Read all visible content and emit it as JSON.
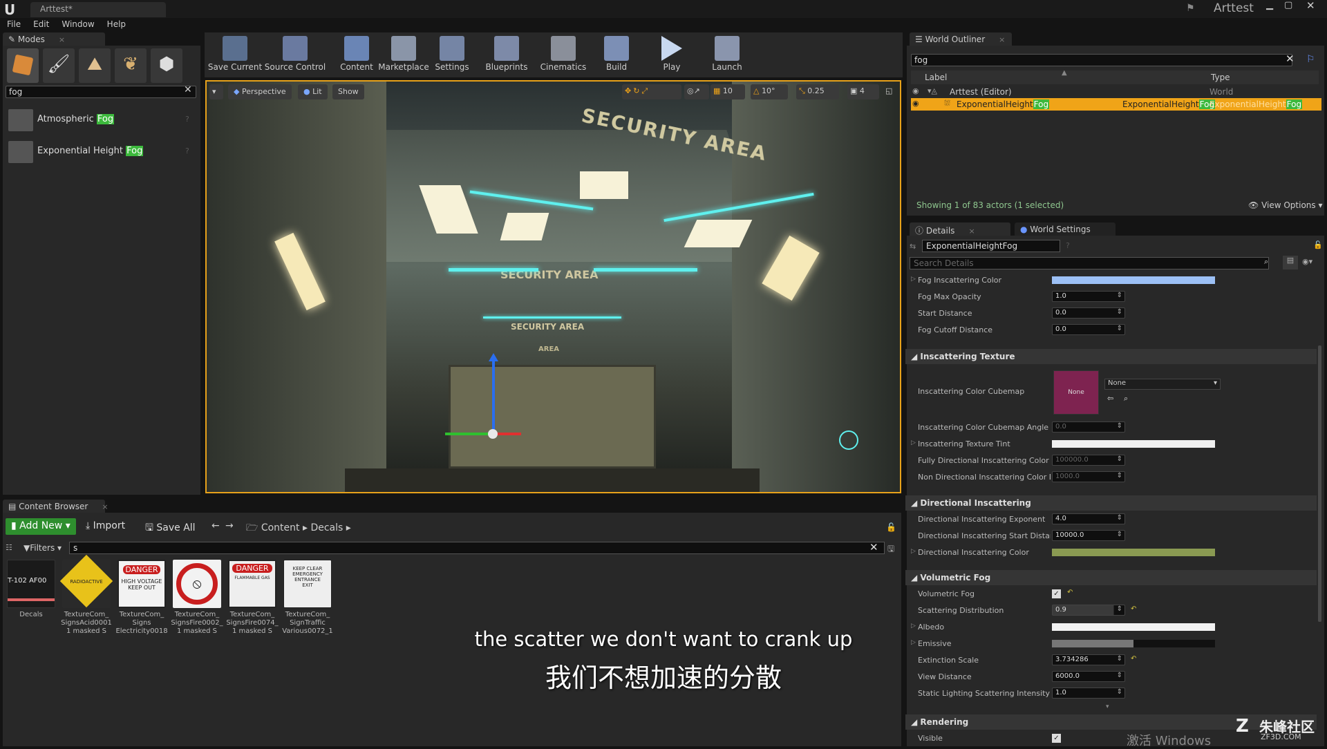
{
  "titlebar": {
    "app_logo": "U",
    "tab": "Arttest*",
    "project": "Arttest"
  },
  "menu": [
    "File",
    "Edit",
    "Window",
    "Help"
  ],
  "modes": {
    "tab": "Modes",
    "search": "fog",
    "items": [
      {
        "pre": "Atmospheric ",
        "hl": "Fog"
      },
      {
        "pre": "Exponential Height ",
        "hl": "Fog"
      }
    ]
  },
  "toolbar": [
    "Save Current",
    "Source Control",
    "Content",
    "Marketplace",
    "Settings",
    "Blueprints",
    "Cinematics",
    "Build",
    "Play",
    "Launch"
  ],
  "viewport": {
    "perspective": "Perspective",
    "lit": "Lit",
    "show": "Show",
    "grid": "10",
    "rot": "10°",
    "scale": "0.25",
    "cam": "4",
    "sign": "SECURITY AREA",
    "sign2": "SECURITY AREA",
    "sign3": "SECURITY AREA",
    "sign4": "AREA"
  },
  "outliner": {
    "tab": "World Outliner",
    "search": "fog",
    "col_label": "Label",
    "col_type": "Type",
    "rows": [
      {
        "label": "Arttest (Editor)",
        "type": "World"
      },
      {
        "label_pre": "ExponentialHeight",
        "label_hl": "Fog",
        "type_pre": "ExponentialHeight",
        "type_hl": "Fog",
        "type2_pre": "ExponentialHeight",
        "type2_hl": "Fog"
      }
    ],
    "status": "Showing 1 of 83 actors (1 selected)",
    "view_options": "View Options"
  },
  "details": {
    "tab": "Details",
    "tab2": "World Settings",
    "actor": "ExponentialHeightFog",
    "search_placeholder": "Search Details",
    "rows1": [
      {
        "label": "Fog Inscattering Color"
      },
      {
        "label": "Fog Max Opacity",
        "value": "1.0"
      },
      {
        "label": "Start Distance",
        "value": "0.0"
      },
      {
        "label": "Fog Cutoff Distance",
        "value": "0.0"
      }
    ],
    "cat_inscat": "Inscattering Texture",
    "cubemap_label": "Inscattering Color Cubemap",
    "cubemap_none": "None",
    "cubemap_select": "None",
    "rows2": [
      {
        "label": "Inscattering Color Cubemap Angle",
        "value": "0.0"
      },
      {
        "label": "Inscattering Texture Tint"
      },
      {
        "label": "Fully Directional Inscattering Color Dis",
        "value": "100000.0"
      },
      {
        "label": "Non Directional Inscattering Color Dist",
        "value": "1000.0"
      }
    ],
    "cat_dir": "Directional Inscattering",
    "rows3": [
      {
        "label": "Directional Inscattering Exponent",
        "value": "4.0"
      },
      {
        "label": "Directional Inscattering Start Distance",
        "value": "10000.0"
      },
      {
        "label": "Directional Inscattering Color"
      }
    ],
    "cat_vol": "Volumetric Fog",
    "rows4": [
      {
        "label": "Volumetric Fog"
      },
      {
        "label": "Scattering Distribution",
        "value": "0.9"
      },
      {
        "label": "Albedo"
      },
      {
        "label": "Emissive"
      },
      {
        "label": "Extinction Scale",
        "value": "3.734286"
      },
      {
        "label": "View Distance",
        "value": "6000.0"
      },
      {
        "label": "Static Lighting Scattering Intensity",
        "value": "1.0"
      }
    ],
    "cat_render": "Rendering",
    "visible_label": "Visible"
  },
  "content_browser": {
    "tab": "Content Browser",
    "add_new": "Add New",
    "import": "Import",
    "save_all": "Save All",
    "path": [
      "Content",
      "Decals"
    ],
    "filters": "Filters",
    "search": "s",
    "assets": [
      {
        "l1": "Decals"
      },
      {
        "l1": "TextureCom_",
        "l2": "SignsAcid0001",
        "l3": "1 masked S"
      },
      {
        "l1": "TextureCom_",
        "l2": "Signs",
        "l3": "Electricity0018"
      },
      {
        "l1": "TextureCom_",
        "l2": "SignsFire0002_",
        "l3": "1 masked S"
      },
      {
        "l1": "TextureCom_",
        "l2": "SignsFire0074_",
        "l3": "1 masked S"
      },
      {
        "l1": "TextureCom_",
        "l2": "SignTraffic",
        "l3": "Various0072_1"
      }
    ],
    "thumb_text": [
      "T-102 AF00",
      "RADIOACTIVE",
      "DANGER",
      "HIGH VOLTAGE",
      "KEEP OUT",
      "DANGER",
      "FLAMMABLE GAS",
      "KEEP CLEAR",
      "EMERGENCY",
      "ENTRANCE",
      "EXIT"
    ]
  },
  "subtitle": {
    "en": "the scatter we don't want to crank up",
    "zh": "我们不想加速的分散"
  },
  "watermark": {
    "win": "激活 Windows",
    "logo": "朱峰社区",
    "url": "ZF3D.COM"
  },
  "colors": {
    "accent_green": "#3cb93c",
    "selection": "#f0a418",
    "fog_color": "#9cc0f5",
    "dir_color": "#8a9a52"
  }
}
